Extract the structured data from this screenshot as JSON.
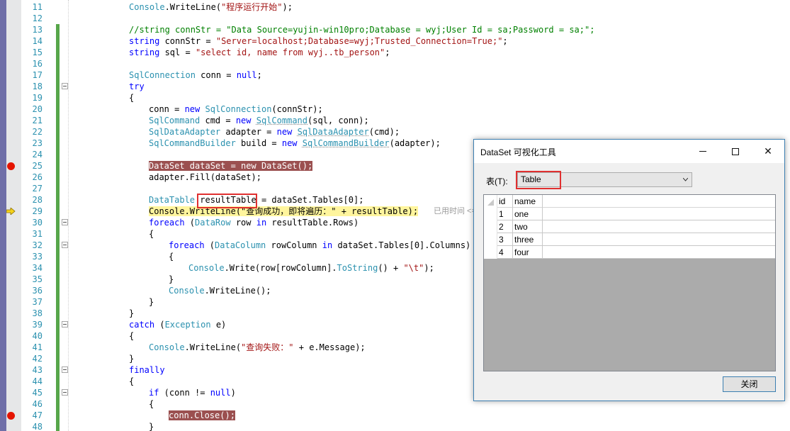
{
  "editor": {
    "lines": [
      {
        "num": "11",
        "indent": 0,
        "tokens": [
          {
            "t": "Console",
            "c": "ty"
          },
          {
            "t": ".WriteLine(",
            "c": ""
          },
          {
            "t": "\"程序运行开始\"",
            "c": "st"
          },
          {
            "t": ");",
            "c": ""
          }
        ]
      },
      {
        "num": "12",
        "indent": 0,
        "tokens": []
      },
      {
        "num": "13",
        "indent": 0,
        "tokens": [
          {
            "t": "//string connStr = \"Data Source=yujin-win10pro;Database = wyj;User Id = sa;Password = sa;\";",
            "c": "cm"
          }
        ]
      },
      {
        "num": "14",
        "indent": 0,
        "tokens": [
          {
            "t": "string",
            "c": "kw"
          },
          {
            "t": " connStr = ",
            "c": ""
          },
          {
            "t": "\"Server=localhost;Database=wyj;Trusted_Connection=True;\"",
            "c": "st"
          },
          {
            "t": ";",
            "c": ""
          }
        ]
      },
      {
        "num": "15",
        "indent": 0,
        "tokens": [
          {
            "t": "string",
            "c": "kw"
          },
          {
            "t": " sql = ",
            "c": ""
          },
          {
            "t": "\"select id, name from wyj..tb_person\"",
            "c": "st"
          },
          {
            "t": ";",
            "c": ""
          }
        ]
      },
      {
        "num": "16",
        "indent": 0,
        "tokens": []
      },
      {
        "num": "17",
        "indent": 0,
        "tokens": [
          {
            "t": "SqlConnection",
            "c": "ty"
          },
          {
            "t": " conn = ",
            "c": ""
          },
          {
            "t": "null",
            "c": "kw"
          },
          {
            "t": ";",
            "c": ""
          }
        ]
      },
      {
        "num": "18",
        "indent": 0,
        "tokens": [
          {
            "t": "try",
            "c": "kw"
          }
        ]
      },
      {
        "num": "19",
        "indent": 0,
        "tokens": [
          {
            "t": "{",
            "c": ""
          }
        ]
      },
      {
        "num": "20",
        "indent": 1,
        "tokens": [
          {
            "t": "conn = ",
            "c": ""
          },
          {
            "t": "new",
            "c": "kw"
          },
          {
            "t": " ",
            "c": ""
          },
          {
            "t": "SqlConnection",
            "c": "ty"
          },
          {
            "t": "(connStr);",
            "c": ""
          }
        ]
      },
      {
        "num": "21",
        "indent": 1,
        "tokens": [
          {
            "t": "SqlCommand",
            "c": "ty"
          },
          {
            "t": " cmd = ",
            "c": ""
          },
          {
            "t": "new",
            "c": "kw"
          },
          {
            "t": " ",
            "c": ""
          },
          {
            "t": "SqlCommand",
            "c": "ty sq"
          },
          {
            "t": "(sql, conn);",
            "c": ""
          }
        ]
      },
      {
        "num": "22",
        "indent": 1,
        "tokens": [
          {
            "t": "SqlDataAdapter",
            "c": "ty"
          },
          {
            "t": " adapter = ",
            "c": ""
          },
          {
            "t": "new",
            "c": "kw"
          },
          {
            "t": " ",
            "c": ""
          },
          {
            "t": "SqlDataAdapter",
            "c": "ty sq"
          },
          {
            "t": "(cmd);",
            "c": ""
          }
        ]
      },
      {
        "num": "23",
        "indent": 1,
        "tokens": [
          {
            "t": "SqlCommandBuilder",
            "c": "ty"
          },
          {
            "t": " build = ",
            "c": ""
          },
          {
            "t": "new",
            "c": "kw"
          },
          {
            "t": " ",
            "c": ""
          },
          {
            "t": "SqlCommandBuilder",
            "c": "ty sq"
          },
          {
            "t": "(adapter);",
            "c": ""
          }
        ]
      },
      {
        "num": "24",
        "indent": 0,
        "tokens": []
      },
      {
        "num": "25",
        "indent": 1,
        "tokens": [
          {
            "t": "DataSet dataSet = new DataSet();",
            "c": "bp-hl"
          }
        ]
      },
      {
        "num": "26",
        "indent": 1,
        "tokens": [
          {
            "t": "adapter.Fill(dataSet);",
            "c": ""
          }
        ]
      },
      {
        "num": "27",
        "indent": 0,
        "tokens": []
      },
      {
        "num": "28",
        "indent": 1,
        "tokens": [
          {
            "t": "DataTable",
            "c": "ty"
          },
          {
            "t": " resultTable = dataSet.Tables[0];",
            "c": ""
          }
        ]
      },
      {
        "num": "29",
        "indent": 1,
        "tokens": [
          {
            "t": "Console.WriteLine(\"查询成功，即将遍历：\" + resultTable);",
            "c": "cur-hl"
          }
        ]
      },
      {
        "num": "30",
        "indent": 1,
        "tokens": [
          {
            "t": "foreach",
            "c": "kw"
          },
          {
            "t": " (",
            "c": ""
          },
          {
            "t": "DataRow",
            "c": "ty"
          },
          {
            "t": " row ",
            "c": ""
          },
          {
            "t": "in",
            "c": "kw"
          },
          {
            "t": " resultTable.Rows)",
            "c": ""
          }
        ]
      },
      {
        "num": "31",
        "indent": 1,
        "tokens": [
          {
            "t": "{",
            "c": ""
          }
        ]
      },
      {
        "num": "32",
        "indent": 2,
        "tokens": [
          {
            "t": "foreach",
            "c": "kw"
          },
          {
            "t": " (",
            "c": ""
          },
          {
            "t": "DataColumn",
            "c": "ty"
          },
          {
            "t": " rowColumn ",
            "c": ""
          },
          {
            "t": "in",
            "c": "kw"
          },
          {
            "t": " dataSet.Tables[0].Columns)",
            "c": ""
          }
        ]
      },
      {
        "num": "33",
        "indent": 2,
        "tokens": [
          {
            "t": "{",
            "c": ""
          }
        ]
      },
      {
        "num": "34",
        "indent": 3,
        "tokens": [
          {
            "t": "Console",
            "c": "ty"
          },
          {
            "t": ".Write(row[rowColumn].",
            "c": ""
          },
          {
            "t": "ToString",
            "c": "ty"
          },
          {
            "t": "() + ",
            "c": ""
          },
          {
            "t": "\"\\t\"",
            "c": "st"
          },
          {
            "t": ");",
            "c": ""
          }
        ]
      },
      {
        "num": "35",
        "indent": 2,
        "tokens": [
          {
            "t": "}",
            "c": ""
          }
        ]
      },
      {
        "num": "36",
        "indent": 2,
        "tokens": [
          {
            "t": "Console",
            "c": "ty"
          },
          {
            "t": ".WriteLine();",
            "c": ""
          }
        ]
      },
      {
        "num": "37",
        "indent": 1,
        "tokens": [
          {
            "t": "}",
            "c": ""
          }
        ]
      },
      {
        "num": "38",
        "indent": 0,
        "tokens": [
          {
            "t": "}",
            "c": ""
          }
        ]
      },
      {
        "num": "39",
        "indent": 0,
        "tokens": [
          {
            "t": "catch",
            "c": "kw"
          },
          {
            "t": " (",
            "c": ""
          },
          {
            "t": "Exception",
            "c": "ty"
          },
          {
            "t": " e)",
            "c": ""
          }
        ]
      },
      {
        "num": "40",
        "indent": 0,
        "tokens": [
          {
            "t": "{",
            "c": ""
          }
        ]
      },
      {
        "num": "41",
        "indent": 1,
        "tokens": [
          {
            "t": "Console",
            "c": "ty"
          },
          {
            "t": ".WriteLine(",
            "c": ""
          },
          {
            "t": "\"查询失败：\"",
            "c": "st"
          },
          {
            "t": " + e.Message);",
            "c": ""
          }
        ]
      },
      {
        "num": "42",
        "indent": 0,
        "tokens": [
          {
            "t": "}",
            "c": ""
          }
        ]
      },
      {
        "num": "43",
        "indent": 0,
        "tokens": [
          {
            "t": "finally",
            "c": "kw"
          }
        ]
      },
      {
        "num": "44",
        "indent": 0,
        "tokens": [
          {
            "t": "{",
            "c": ""
          }
        ]
      },
      {
        "num": "45",
        "indent": 1,
        "tokens": [
          {
            "t": "if",
            "c": "kw"
          },
          {
            "t": " (conn != ",
            "c": ""
          },
          {
            "t": "null",
            "c": "kw"
          },
          {
            "t": ")",
            "c": ""
          }
        ]
      },
      {
        "num": "46",
        "indent": 1,
        "tokens": [
          {
            "t": "{",
            "c": ""
          }
        ]
      },
      {
        "num": "47",
        "indent": 2,
        "tokens": [
          {
            "t": "conn.Close();",
            "c": "bp-hl"
          }
        ]
      },
      {
        "num": "48",
        "indent": 1,
        "tokens": [
          {
            "t": "}",
            "c": ""
          }
        ]
      }
    ],
    "breakpoint_lines": [
      "25",
      "47"
    ],
    "current_line": "29",
    "fold_lines": [
      "18",
      "30",
      "32",
      "39",
      "43",
      "45"
    ],
    "changed_lines": [
      "13",
      "14",
      "15",
      "16",
      "17",
      "18",
      "19",
      "20",
      "21",
      "22",
      "23",
      "24",
      "25",
      "26",
      "27",
      "28",
      "29",
      "30",
      "31",
      "32",
      "33",
      "34",
      "35",
      "36",
      "37",
      "38",
      "39",
      "40",
      "41",
      "42",
      "43",
      "44",
      "45",
      "46",
      "47",
      "48"
    ],
    "elapsed_hint": "已用时间 <="
  },
  "dialog": {
    "title": "DataSet 可视化工具",
    "table_label": "表(T):",
    "table_select_value": "Table",
    "grid": {
      "columns": [
        "id",
        "name"
      ],
      "rows": [
        [
          "1",
          "one"
        ],
        [
          "2",
          "two"
        ],
        [
          "3",
          "three"
        ],
        [
          "4",
          "four"
        ]
      ]
    },
    "close_button": "关闭",
    "close_glyph": "✕"
  },
  "colors": {
    "keyword": "#0000ff",
    "type": "#2b91af",
    "string": "#a31515",
    "comment": "#008000",
    "breakpoint": "#e51400",
    "current_line_bg": "#fff59d",
    "highlight_box": "#e03030"
  }
}
